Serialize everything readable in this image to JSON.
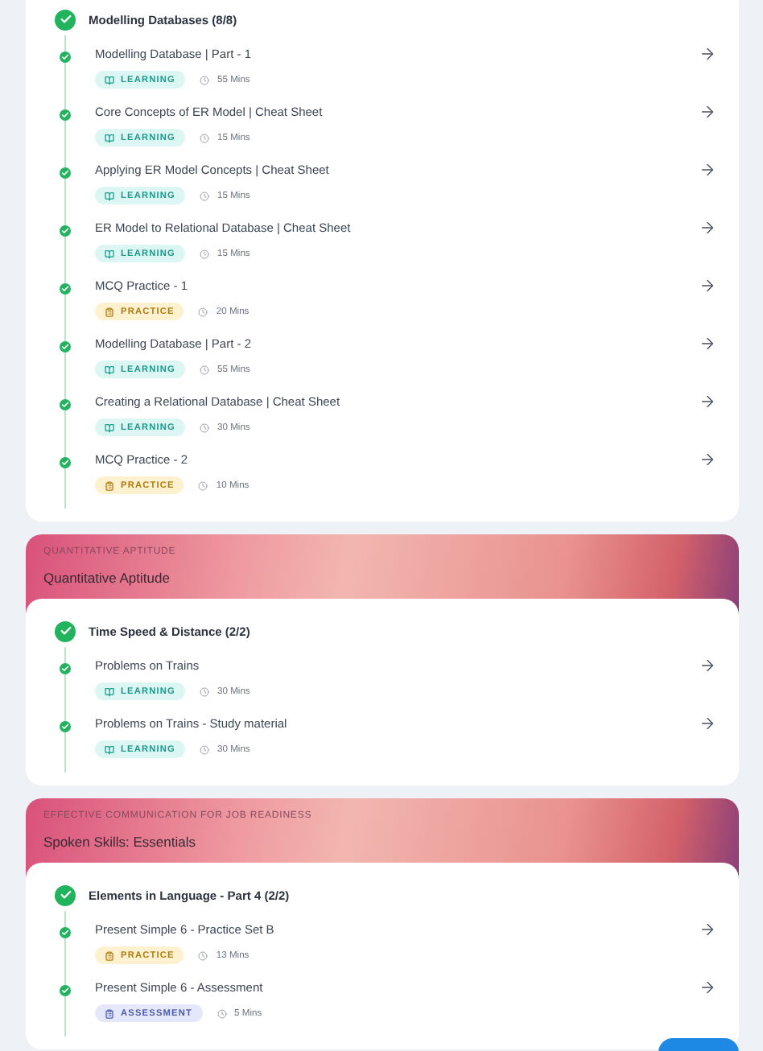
{
  "modules": [
    {
      "sections": [
        {
          "title": "Modelling Databases (8/8)",
          "completed": true,
          "items": [
            {
              "title": "Modelling Database | Part - 1",
              "kind": "learning",
              "tag": "LEARNING",
              "duration": "55 Mins",
              "completed": true
            },
            {
              "title": "Core Concepts of ER Model | Cheat Sheet",
              "kind": "learning",
              "tag": "LEARNING",
              "duration": "15 Mins",
              "completed": true
            },
            {
              "title": "Applying ER Model Concepts | Cheat Sheet",
              "kind": "learning",
              "tag": "LEARNING",
              "duration": "15 Mins",
              "completed": true
            },
            {
              "title": "ER Model to Relational Database | Cheat Sheet",
              "kind": "learning",
              "tag": "LEARNING",
              "duration": "15 Mins",
              "completed": true
            },
            {
              "title": "MCQ Practice - 1",
              "kind": "practice",
              "tag": "PRACTICE",
              "duration": "20 Mins",
              "completed": true
            },
            {
              "title": "Modelling Database | Part - 2",
              "kind": "learning",
              "tag": "LEARNING",
              "duration": "55 Mins",
              "completed": true
            },
            {
              "title": "Creating a Relational Database | Cheat Sheet",
              "kind": "learning",
              "tag": "LEARNING",
              "duration": "30 Mins",
              "completed": true
            },
            {
              "title": "MCQ Practice - 2",
              "kind": "practice",
              "tag": "PRACTICE",
              "duration": "10 Mins",
              "completed": true
            }
          ]
        }
      ]
    },
    {
      "category": "QUANTITATIVE APTITUDE",
      "title": "Quantitative Aptitude",
      "sections": [
        {
          "title": "Time Speed & Distance (2/2)",
          "completed": true,
          "items": [
            {
              "title": "Problems on Trains",
              "kind": "learning",
              "tag": "LEARNING",
              "duration": "30 Mins",
              "completed": true
            },
            {
              "title": "Problems on Trains - Study material",
              "kind": "learning",
              "tag": "LEARNING",
              "duration": "30 Mins",
              "completed": true
            }
          ]
        }
      ]
    },
    {
      "category": "EFFECTIVE COMMUNICATION FOR JOB READINESS",
      "title": "Spoken Skills: Essentials",
      "sections": [
        {
          "title": "Elements in Language - Part 4 (2/2)",
          "completed": true,
          "items": [
            {
              "title": "Present Simple 6 - Practice Set B",
              "kind": "practice",
              "tag": "PRACTICE",
              "duration": "13 Mins",
              "completed": true
            },
            {
              "title": "Present Simple 6 - Assessment",
              "kind": "assessment",
              "tag": "ASSESSMENT",
              "duration": "5 Mins",
              "completed": true
            }
          ]
        }
      ]
    }
  ]
}
